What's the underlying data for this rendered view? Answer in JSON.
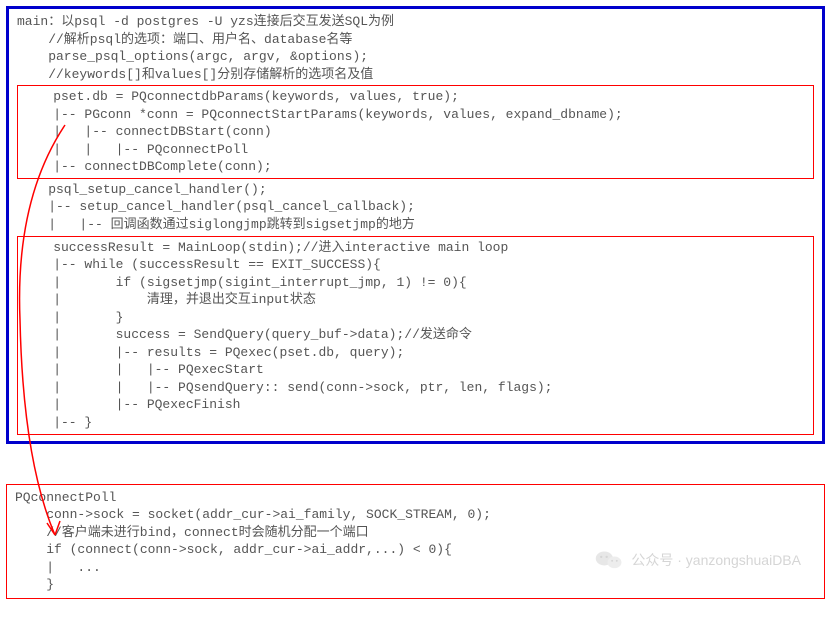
{
  "main": {
    "line1": "main：以psql -d postgres -U yzs连接后交互发送SQL为例",
    "line2": "    //解析psql的选项：端口、用户名、database名等",
    "line3": "    parse_psql_options(argc, argv, &options);",
    "line4": "    //keywords[]和values[]分别存储解析的选项名及值"
  },
  "box1": {
    "l1": "    pset.db = PQconnectdbParams(keywords, values, true);",
    "l2": "    |-- PGconn *conn = PQconnectStartParams(keywords, values, expand_dbname);",
    "l3": "    |   |-- connectDBStart(conn)",
    "l4": "    |   |   |-- PQconnectPoll",
    "l5": "    |-- connectDBComplete(conn);"
  },
  "mid": {
    "l1": "    psql_setup_cancel_handler();",
    "l2": "    |-- setup_cancel_handler(psql_cancel_callback);",
    "l3": "    |   |-- 回调函数通过siglongjmp跳转到sigsetjmp的地方"
  },
  "box2": {
    "l1": "    successResult = MainLoop(stdin);//进入interactive main loop",
    "l2": "    |-- while (successResult == EXIT_SUCCESS){",
    "l3": "    |       if (sigsetjmp(sigint_interrupt_jmp, 1) != 0){",
    "l4": "    |           清理，并退出交互input状态",
    "l5": "    |       }",
    "l6": "    |       success = SendQuery(query_buf->data);//发送命令",
    "l7": "    |       |-- results = PQexec(pset.db, query);",
    "l8": "    |       |   |-- PQexecStart",
    "l9": "    |       |   |-- PQsendQuery:: send(conn->sock, ptr, len, flags);",
    "l10": "    |       |-- PQexecFinish",
    "l11": "    |-- }"
  },
  "box3": {
    "l1": "PQconnectPoll",
    "l2": "    conn->sock = socket(addr_cur->ai_family, SOCK_STREAM, 0);",
    "l3": "    //客户端未进行bind，connect时会随机分配一个端口",
    "l4": "    if (connect(conn->sock, addr_cur->ai_addr,...) < 0){",
    "l5": "    |   ...",
    "l6": "    }"
  },
  "watermark": {
    "text": "公众号 · yanzongshuaiDBA"
  }
}
